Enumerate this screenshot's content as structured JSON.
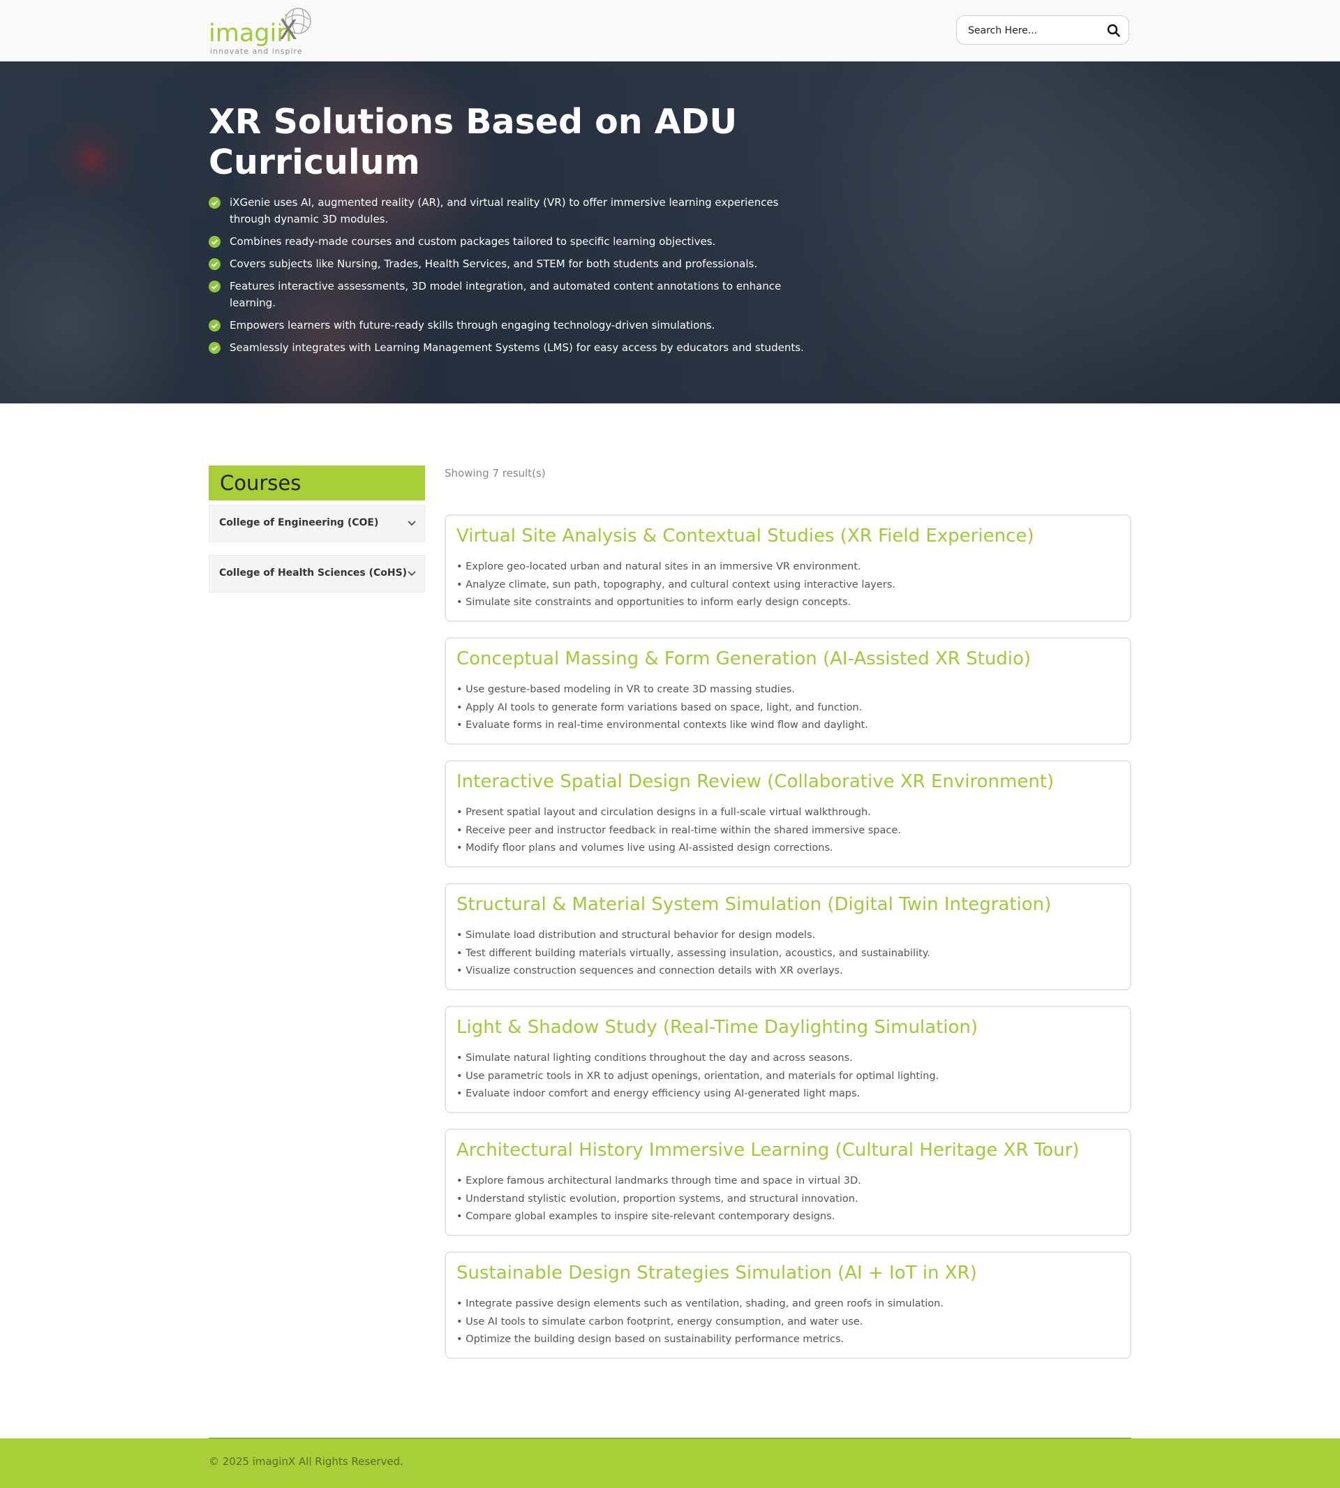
{
  "header": {
    "logo_text": "imagin",
    "logo_x": "X",
    "logo_tagline": "innovate and inspire",
    "search_placeholder": "Search Here..."
  },
  "hero": {
    "title": "XR Solutions Based on ADU Curriculum",
    "features": [
      "iXGenie uses AI, augmented reality (AR), and virtual reality (VR) to offer immersive learning experiences through dynamic 3D modules.",
      "Combines ready-made courses and custom packages tailored to specific learning objectives.",
      "Covers subjects like Nursing, Trades, Health Services, and STEM for both students and professionals.",
      "Features interactive assessments, 3D model integration, and automated content annotations to enhance learning.",
      "Empowers learners with future-ready skills through engaging technology-driven simulations.",
      "Seamlessly integrates with Learning Management Systems (LMS) for easy access by educators and students."
    ]
  },
  "sidebar": {
    "title": "Courses",
    "categories": [
      "College of Engineering (COE)",
      "College of Health Sciences (CoHS)"
    ]
  },
  "results": {
    "count_text": "Showing 7 result(s)"
  },
  "courses": [
    {
      "title": "Virtual Site Analysis & Contextual Studies (XR Field Experience)",
      "points": [
        "• Explore geo-located urban and natural sites in an immersive VR environment.",
        "• Analyze climate, sun path, topography, and cultural context using interactive layers.",
        "• Simulate site constraints and opportunities to inform early design concepts."
      ]
    },
    {
      "title": "Conceptual Massing & Form Generation (AI-Assisted XR Studio)",
      "points": [
        "• Use gesture-based modeling in VR to create 3D massing studies.",
        "• Apply AI tools to generate form variations based on space, light, and function.",
        "• Evaluate forms in real-time environmental contexts like wind flow and daylight."
      ]
    },
    {
      "title": "Interactive Spatial Design Review (Collaborative XR Environment)",
      "points": [
        "• Present spatial layout and circulation designs in a full-scale virtual walkthrough.",
        "• Receive peer and instructor feedback in real-time within the shared immersive space.",
        "• Modify floor plans and volumes live using AI-assisted design corrections."
      ]
    },
    {
      "title": "Structural & Material System Simulation (Digital Twin Integration)",
      "points": [
        "• Simulate load distribution and structural behavior for design models.",
        "• Test different building materials virtually, assessing insulation, acoustics, and sustainability.",
        "• Visualize construction sequences and connection details with XR overlays."
      ]
    },
    {
      "title": "Light & Shadow Study (Real-Time Daylighting Simulation)",
      "points": [
        "• Simulate natural lighting conditions throughout the day and across seasons.",
        "• Use parametric tools in XR to adjust openings, orientation, and materials for optimal lighting.",
        "• Evaluate indoor comfort and energy efficiency using AI-generated light maps."
      ]
    },
    {
      "title": "Architectural History Immersive Learning (Cultural Heritage XR Tour)",
      "points": [
        "• Explore famous architectural landmarks through time and space in virtual 3D.",
        "• Understand stylistic evolution, proportion systems, and structural innovation.",
        "• Compare global examples to inspire site-relevant contemporary designs."
      ]
    },
    {
      "title": "Sustainable Design Strategies Simulation (AI + IoT in XR)",
      "points": [
        "• Integrate passive design elements such as ventilation, shading, and green roofs in simulation.",
        "• Use AI tools to simulate carbon footprint, energy consumption, and water use.",
        "• Optimize the building design based on sustainability performance metrics."
      ]
    }
  ],
  "footer": {
    "copyright": "© 2025 imaginX All Rights Reserved."
  },
  "colors": {
    "accent": "#a9cf38",
    "title_green": "#a3c93a",
    "check_green": "#8dc63f"
  },
  "icons": {
    "search": "search-icon",
    "check": "check-circle-icon",
    "chevron": "chevron-down-icon"
  }
}
